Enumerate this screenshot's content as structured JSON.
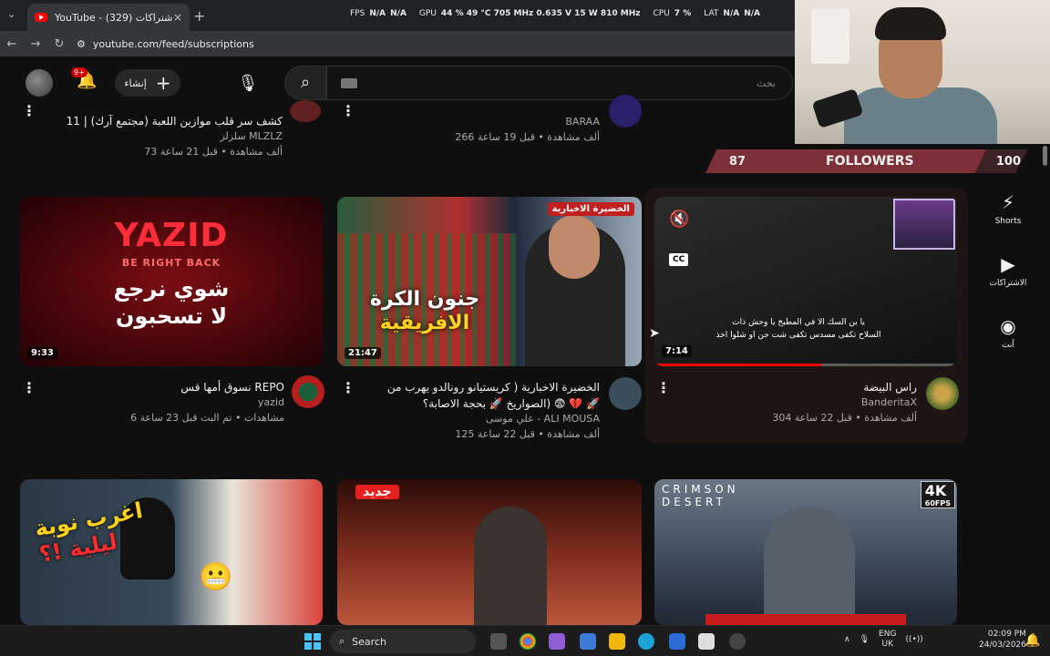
{
  "browser": {
    "tab_title": "YouTube - (329) الاشتراكات",
    "tab_close": "×",
    "new_tab": "+",
    "tabs_menu": "⌄",
    "url": "youtube.com/feed/subscriptions",
    "back": "←",
    "forward": "→",
    "reload": "↻",
    "site_info": "⚙"
  },
  "overlay_perf": {
    "fps_label": "FPS",
    "fps_v1": "N/A",
    "fps_v2": "N/A",
    "gpu_label": "GPU",
    "gpu_vals": "44 % 49 °C 705 MHz 0.635 V 15 W 810 MHz",
    "cpu_label": "CPU",
    "cpu_val": "7 %",
    "lat_label": "LAT",
    "lat_v1": "N/A",
    "lat_v2": "N/A"
  },
  "header": {
    "create_label": "إنشاء",
    "create_icon": "+",
    "search_placeholder": "بحث",
    "notification_badge": "9+",
    "bell_icon": "🔔",
    "mic_icon": "🎙",
    "search_icon": "⌕"
  },
  "followers_widget": {
    "current": "87",
    "label": "FOLLOWERS",
    "goal": "100",
    "progress": 0.87
  },
  "top_row": [
    {
      "title": "11 | كشف سر قلب موازين اللعبة (مجتمع آرك)",
      "channel": "سلزلز MLZLZ",
      "meta": "73 ألف مشاهدة • قبل 21 ساعة"
    },
    {
      "title": "",
      "channel": "BARAA",
      "meta": "266 ألف مشاهدة • قبل 19 ساعة"
    }
  ],
  "videos": [
    {
      "thumb_big": "YAZID",
      "thumb_small": "BE RIGHT BACK",
      "thumb_ar_1": "شوي نرجع",
      "thumb_ar_2": "لا تسحبون",
      "duration": "9:33",
      "title": "نسوق أمها قس REPO",
      "channel": "yazid",
      "meta": "6 مشاهدات • تم البث قبل 23 ساعة",
      "kebab": "⋮"
    },
    {
      "thumb_banner_1": "جنون الكرة",
      "thumb_banner_2": "الافريقية",
      "thumb_logo": "الخضيرة الاخبارية",
      "duration": "21:47",
      "title_1": "الخضيرة الاخبارية ( كريستيانو رونالدو يهرب من",
      "title_2": "الصواريخ 🚀 بحجة الاصابة؟) 😨 💔 🚀",
      "channel": "علي موسى - ALI MOUSA",
      "meta": "125 ألف مشاهدة • قبل 22 ساعة",
      "kebab": "⋮"
    },
    {
      "mute_icon": "🔇",
      "cc_label": "CC",
      "caption_1": "يا بن السك الا في المطبخ يا وحش ذات",
      "caption_2": "السلاح تكفى مسدس تكفى شت جن او شلوا اخذ",
      "duration": "7:14",
      "progress": 0.55,
      "title": "راس البيضة",
      "channel": "BanderitaX",
      "meta": "304 ألف مشاهدة • قبل 22 ساعة",
      "kebab": "⋮"
    }
  ],
  "bottom_row": [
    {
      "thumb_text_1": "اغرب نوبة",
      "thumb_text_2": "ليلية !؟",
      "emoji": "😬"
    },
    {
      "badge": "جديد"
    },
    {
      "thumb_title_1": "CRIMSON",
      "thumb_title_2": "DESERT",
      "badge_4k": "4K",
      "badge_fps": "60FPS"
    }
  ],
  "guide": {
    "shorts_label": "Shorts",
    "subscriptions_label": "الاشتراكات",
    "you_label": "أنت",
    "shorts_icon": "⚡",
    "subs_icon": "▶",
    "you_icon": "◉"
  },
  "taskbar": {
    "search_label": "Search",
    "search_icon": "⌕",
    "lang_1": "ENG",
    "lang_2": "UK",
    "time": "02:09 PM",
    "date": "24/03/2026",
    "tray_up": "∧",
    "bell": "🔔"
  },
  "colors": {
    "background": "#0f0f0f",
    "accent_red": "#ff0000",
    "followers_fill": "#7d3038"
  }
}
